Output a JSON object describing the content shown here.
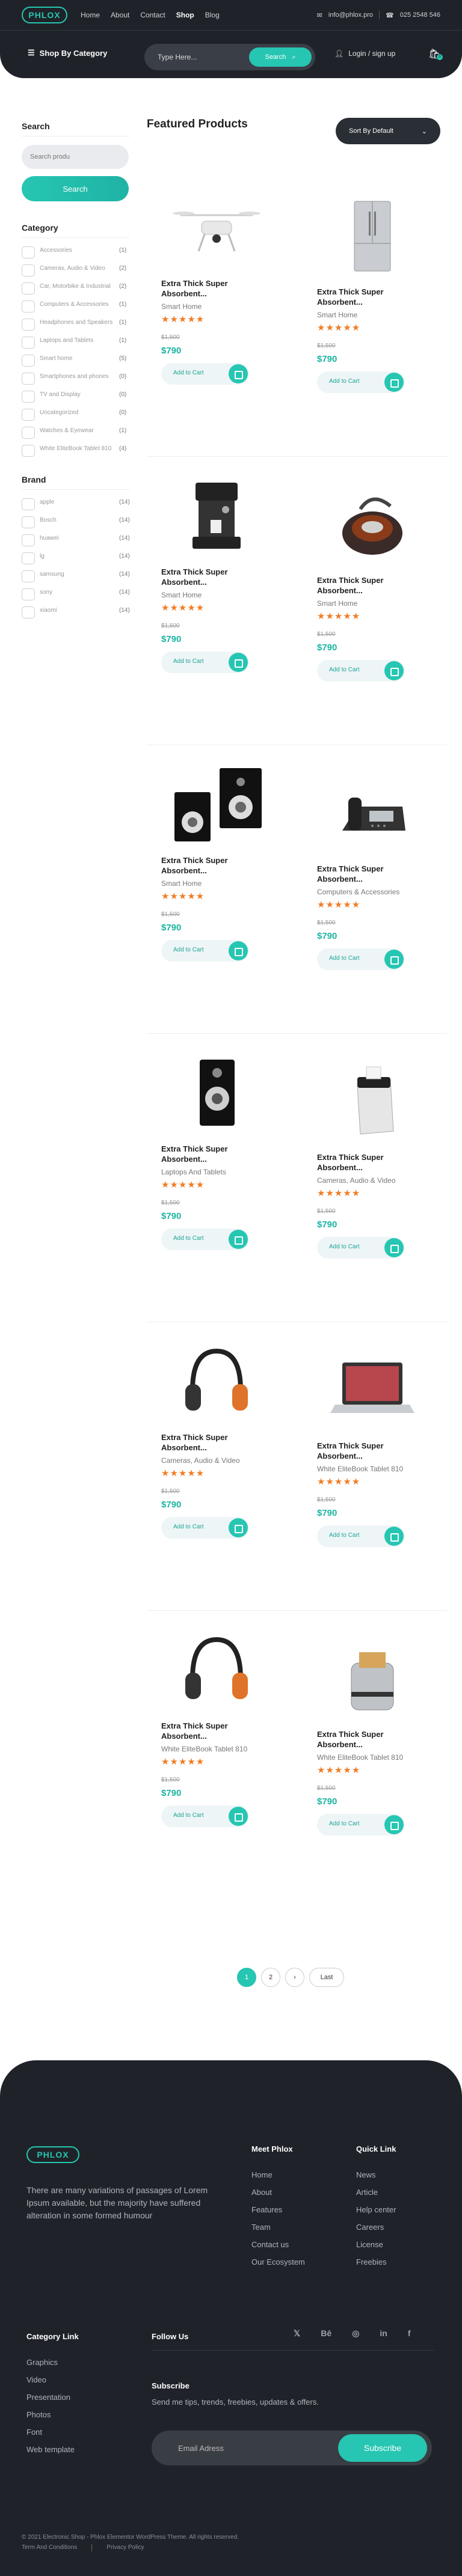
{
  "header": {
    "logo": "PHLOX",
    "nav": [
      "Home",
      "About",
      "Contact",
      "Shop",
      "Blog"
    ],
    "email": "info@phlox.pro",
    "phone": "025 2548 546",
    "shop_by_category": "Shop By Category",
    "search_placeholder": "Type Here...",
    "search_button": "Search",
    "login": "Login / sign up",
    "cart_count": "0"
  },
  "sidebar": {
    "search_title": "Search",
    "search_placeholder": "Search produ",
    "search_button": "Search",
    "category_title": "Category",
    "categories": [
      {
        "label": "Accessories",
        "count": "(1)"
      },
      {
        "label": "Cameras, Audio & Video",
        "count": "(2)"
      },
      {
        "label": "Car, Motorbike & Industrial",
        "count": "(2)"
      },
      {
        "label": "Computers & Accessories",
        "count": "(1)"
      },
      {
        "label": "Headphones and Speakers",
        "count": "(1)"
      },
      {
        "label": "Laptops and Tablets",
        "count": "(1)"
      },
      {
        "label": "Smart home",
        "count": "(5)"
      },
      {
        "label": "Smartphones and phones",
        "count": "(0)"
      },
      {
        "label": "TV and Display",
        "count": "(0)"
      },
      {
        "label": "Uncategorized",
        "count": "(0)"
      },
      {
        "label": "Watches & Eyewear",
        "count": "(1)"
      },
      {
        "label": "White EliteBook Tablet 810",
        "count": "(4)"
      }
    ],
    "brand_title": "Brand",
    "brands": [
      {
        "label": "apple",
        "count": "(14)"
      },
      {
        "label": "Bosch",
        "count": "(14)"
      },
      {
        "label": "huawei",
        "count": "(14)"
      },
      {
        "label": "lg",
        "count": "(14)"
      },
      {
        "label": "samsung",
        "count": "(14)"
      },
      {
        "label": "sony",
        "count": "(14)"
      },
      {
        "label": "xiaomi",
        "count": "(14)"
      }
    ]
  },
  "main": {
    "title": "Featured Products",
    "sort": "Sort By Default",
    "add_to_cart": "Add to Cart",
    "products": [
      {
        "name": "Extra Thick Super Absorbent...",
        "category": "Smart Home",
        "old": "$1,500",
        "price": "$790",
        "icon": "drone-image"
      },
      {
        "name": "Extra Thick Super Absorbent...",
        "category": "Smart Home",
        "old": "$1,500",
        "price": "$790",
        "icon": "refrigerator-image"
      },
      {
        "name": "Extra Thick Super Absorbent...",
        "category": "Smart Home",
        "old": "$1,500",
        "price": "$790",
        "icon": "coffee-machine-image"
      },
      {
        "name": "Extra Thick Super Absorbent...",
        "category": "Smart Home",
        "old": "$1,500",
        "price": "$790",
        "icon": "vacuum-cleaner-image"
      },
      {
        "name": "Extra Thick Super Absorbent...",
        "category": "Smart Home",
        "old": "$1,500",
        "price": "$790",
        "icon": "speakers-image"
      },
      {
        "name": "Extra Thick Super Absorbent...",
        "category": "Computers & Accessories",
        "old": "$1,500",
        "price": "$790",
        "icon": "desk-phone-image"
      },
      {
        "name": "Extra Thick Super Absorbent...",
        "category": "Laptops And Tablets",
        "old": "$1,500",
        "price": "$790",
        "icon": "speaker-image"
      },
      {
        "name": "Extra Thick Super Absorbent...",
        "category": "Cameras, Audio & Video",
        "old": "$1,500",
        "price": "$790",
        "icon": "paper-shredder-image"
      },
      {
        "name": "Extra Thick Super Absorbent...",
        "category": "Cameras, Audio & Video",
        "old": "$1,500",
        "price": "$790",
        "icon": "headphones-image"
      },
      {
        "name": "Extra Thick Super Absorbent...",
        "category": "White EliteBook Tablet 810",
        "old": "$1,500",
        "price": "$790",
        "icon": "laptop-image"
      },
      {
        "name": "Extra Thick Super Absorbent...",
        "category": "White EliteBook Tablet 810",
        "old": "$1,500",
        "price": "$790",
        "icon": "headphones-image"
      },
      {
        "name": "Extra Thick Super Absorbent...",
        "category": "White EliteBook Tablet 810",
        "old": "$1,500",
        "price": "$790",
        "icon": "toaster-image"
      }
    ],
    "rating_stars": 5,
    "pagination": [
      "1",
      "2",
      "›",
      "Last"
    ]
  },
  "footer": {
    "logo": "PHLOX",
    "about": "There are many variations of passages of Lorem Ipsum available, but the majority have suffered alteration in some formed humour",
    "meet_title": "Meet Phlox",
    "meet_links": [
      "Home",
      "About",
      "Features",
      "Team",
      "Contact us",
      "Our Ecosystem"
    ],
    "quick_title": "Quick Link",
    "quick_links": [
      "News",
      "Article",
      "Help center",
      "Careers",
      "License",
      "Freebies"
    ],
    "category_title": "Category Link",
    "category_links": [
      "Graphics",
      "Video",
      "Presentation",
      "Photos",
      "Font",
      "Web template"
    ],
    "follow_title": "Follow Us",
    "social": [
      "twitter-icon",
      "behance-icon",
      "instagram-icon",
      "linkedin-icon",
      "facebook-icon"
    ],
    "subscribe_title": "Subscribe",
    "subscribe_text": "Send me tips, trends, freebies, updates & offers.",
    "email_placeholder": "Email Adress",
    "subscribe_button": "Subscribe",
    "copyright": "© 2021 Electronic Shop - Phlox Elementor WordPress Theme. All rights reserved.",
    "terms": "Term And Conditions",
    "privacy": "Privacy Policy"
  },
  "colors": {
    "accent": "#26c6b2",
    "dark": "#1f2329",
    "star": "#f17c23"
  }
}
